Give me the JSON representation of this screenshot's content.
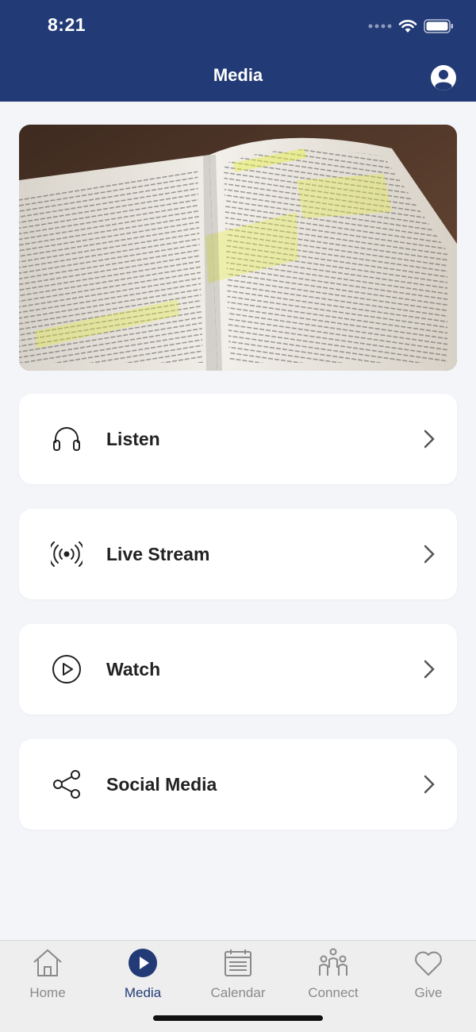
{
  "status": {
    "time": "8:21"
  },
  "header": {
    "title": "Media"
  },
  "menu": [
    {
      "label": "Listen",
      "icon": "headphones-icon"
    },
    {
      "label": "Live Stream",
      "icon": "broadcast-icon"
    },
    {
      "label": "Watch",
      "icon": "play-circle-icon"
    },
    {
      "label": "Social Media",
      "icon": "share-icon"
    }
  ],
  "tabs": [
    {
      "label": "Home",
      "icon": "home-icon",
      "active": false
    },
    {
      "label": "Media",
      "icon": "play-icon",
      "active": true
    },
    {
      "label": "Calendar",
      "icon": "calendar-icon",
      "active": false
    },
    {
      "label": "Connect",
      "icon": "people-icon",
      "active": false
    },
    {
      "label": "Give",
      "icon": "heart-icon",
      "active": false
    }
  ],
  "colors": {
    "brand": "#223a75",
    "background": "#f3f5f9",
    "inactive": "#8a8a8a"
  }
}
